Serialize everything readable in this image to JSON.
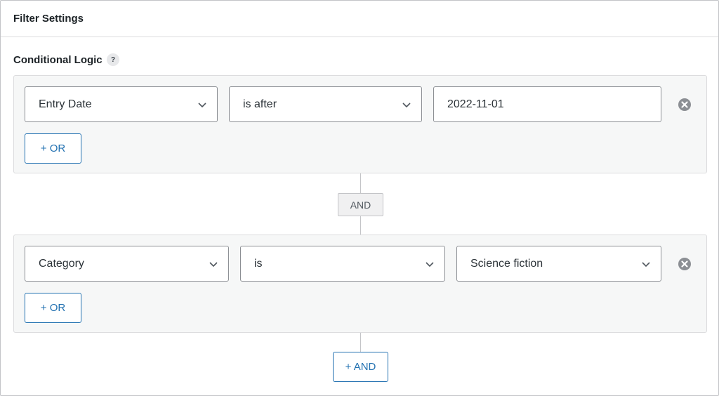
{
  "header": {
    "title": "Filter Settings"
  },
  "conditional_logic": {
    "label": "Conditional Logic",
    "help_icon": "?"
  },
  "groups": [
    {
      "field": "Entry Date",
      "operator": "is after",
      "value": "2022-11-01",
      "or_button": "+ OR"
    },
    {
      "field": "Category",
      "operator": "is",
      "value": "Science fiction",
      "or_button": "+ OR"
    }
  ],
  "connector": "AND",
  "add_and_button": "+ AND",
  "colors": {
    "accent": "#2271b1",
    "border": "#8c8f94",
    "group_bg": "#f6f7f7"
  },
  "icons": [
    "question-mark-icon",
    "chevron-down-icon",
    "remove-circle-icon"
  ]
}
